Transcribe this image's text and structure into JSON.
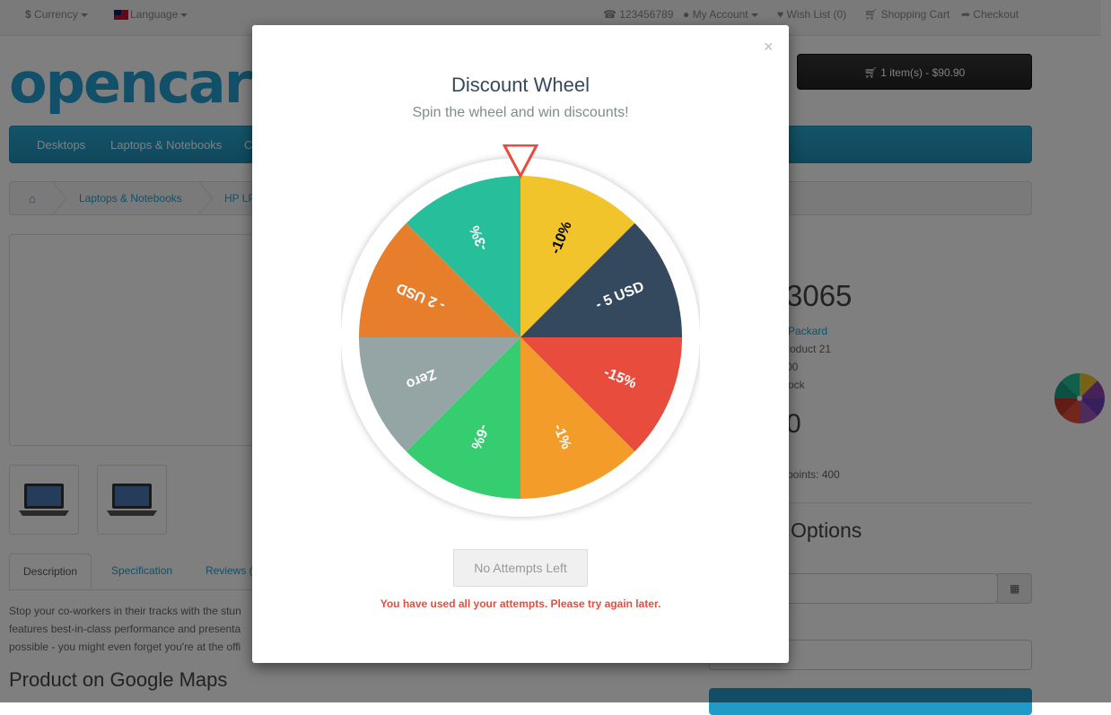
{
  "topbar": {
    "currency": "Currency",
    "language": "Language",
    "phone": "123456789",
    "account": "My Account",
    "wishlist": "Wish List (0)",
    "cart": "Shopping Cart",
    "checkout": "Checkout"
  },
  "header": {
    "logo": "opencart",
    "cart_button": "1 item(s) - $90.90"
  },
  "nav": [
    "Desktops",
    "Laptops & Notebooks",
    "C"
  ],
  "breadcrumb": [
    "Laptops & Notebooks",
    "HP LP"
  ],
  "product": {
    "name_partial": "3065",
    "brand_partial": "Packard",
    "code_partial": "roduct 21",
    "points_partial": "00",
    "stock_partial": "ock",
    "price_partial": "0",
    "reward_partial": "points: 400",
    "options_heading": "Options"
  },
  "tabs": [
    "Description",
    "Specification",
    "Reviews ("
  ],
  "description_lines": [
    "Stop your co-workers in their tracks with the stun",
    "features best-in-class performance and presenta",
    "possible - you might even forget you're at the offi"
  ],
  "maps_heading": "Product on Google Maps",
  "modal": {
    "close": "×",
    "title": "Discount Wheel",
    "subtitle": "Spin the wheel and win discounts!",
    "button": "No Attempts Left",
    "error": "You have used all your attempts. Please try again later."
  },
  "wheel": {
    "segments": [
      {
        "label": "-10%",
        "color": "#f0c42a",
        "text": "#000000"
      },
      {
        "label": "- 5 USD",
        "color": "#34495e",
        "text": "#ffffff"
      },
      {
        "label": "-15%",
        "color": "#e74c3c",
        "text": "#ffffff"
      },
      {
        "label": "-1%",
        "color": "#f39c2a",
        "text": "#ffffff"
      },
      {
        "label": "-6%",
        "color": "#35cd6f",
        "text": "#ffffff"
      },
      {
        "label": "Zero",
        "color": "#95a5a6",
        "text": "#ffffff"
      },
      {
        "label": "- 2 USD",
        "color": "#e67e2c",
        "text": "#ffffff"
      },
      {
        "label": "-3%",
        "color": "#27be9c",
        "text": "#ffffff"
      }
    ],
    "pointer_color": "#e74c3c"
  }
}
